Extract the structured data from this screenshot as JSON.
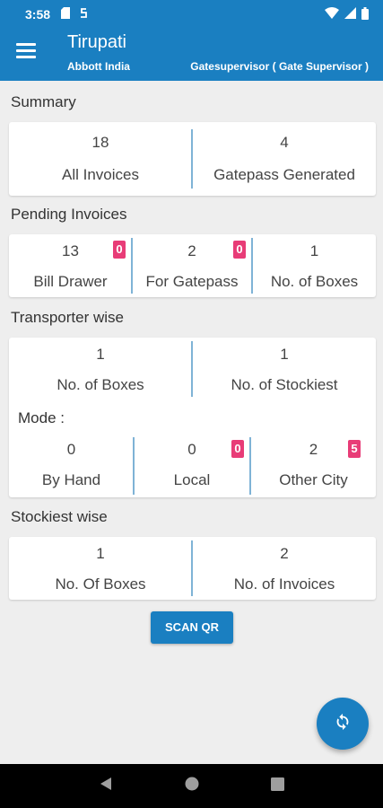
{
  "status_bar": {
    "time": "3:58"
  },
  "app_bar": {
    "title": "Tirupati",
    "subtitle": "Abbott India",
    "role": "Gatesupervisor ( Gate Supervisor )"
  },
  "summary": {
    "title": "Summary",
    "items": [
      {
        "value": "18",
        "label": "All Invoices"
      },
      {
        "value": "4",
        "label": "Gatepass Generated"
      }
    ]
  },
  "pending": {
    "title": "Pending Invoices",
    "items": [
      {
        "value": "13",
        "label": "Bill Drawer",
        "badge": "0"
      },
      {
        "value": "2",
        "label": "For Gatepass",
        "badge": "0"
      },
      {
        "value": "1",
        "label": "No. of Boxes"
      }
    ]
  },
  "transporter": {
    "title": "Transporter wise",
    "items": [
      {
        "value": "1",
        "label": "No. of Boxes"
      },
      {
        "value": "1",
        "label": "No. of Stockiest"
      }
    ],
    "mode_label": "Mode :",
    "modes": [
      {
        "value": "0",
        "label": "By Hand"
      },
      {
        "value": "0",
        "label": "Local",
        "badge": "0"
      },
      {
        "value": "2",
        "label": "Other City",
        "badge": "5"
      }
    ]
  },
  "stockiest": {
    "title": "Stockiest wise",
    "items": [
      {
        "value": "1",
        "label": "No. Of Boxes"
      },
      {
        "value": "2",
        "label": "No. of Invoices"
      }
    ]
  },
  "scan_button": "SCAN QR",
  "icons": [
    "menu-icon",
    "refresh-icon",
    "back-icon",
    "home-icon",
    "recents-icon",
    "wifi-icon",
    "signal-icon",
    "battery-icon"
  ],
  "colors": {
    "primary": "#1a7fc1",
    "badge": "#e83c77",
    "divider": "#7fb3d6"
  }
}
